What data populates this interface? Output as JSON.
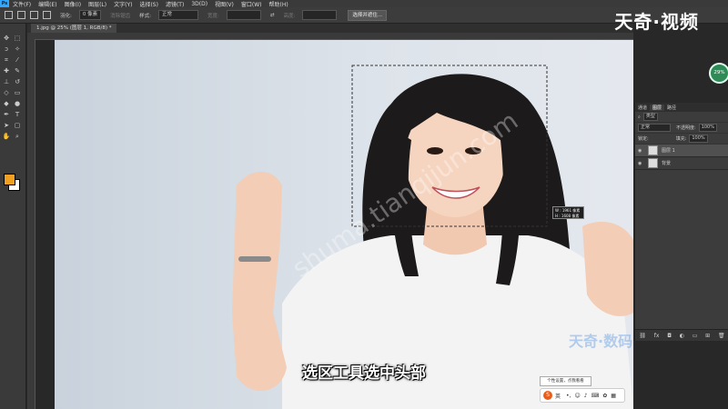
{
  "menu": {
    "items": [
      "文件(F)",
      "编辑(E)",
      "图像(I)",
      "图层(L)",
      "文字(Y)",
      "选择(S)",
      "滤镜(T)",
      "3D(D)",
      "视图(V)",
      "窗口(W)",
      "帮助(H)"
    ]
  },
  "options": {
    "feather_label": "羽化:",
    "feather_value": "0 像素",
    "antialias": "消除锯齿",
    "style_label": "样式:",
    "style_value": "正常",
    "width_label": "宽度:",
    "height_label": "高度:",
    "select_mask_button": "选择并遮住..."
  },
  "document": {
    "tab_title": "1.jpg @ 25% (图层 1, RGB/8) *"
  },
  "layers_panel": {
    "tabs": [
      "图层",
      "通道",
      "路径"
    ],
    "kind_label": "类型",
    "blend_mode": "正常",
    "opacity_label": "不透明度:",
    "opacity_value": "100%",
    "lock_label": "锁定:",
    "fill_label": "填充:",
    "fill_value": "100%",
    "layers": [
      {
        "name": "图层 1",
        "selected": true
      },
      {
        "name": "背景",
        "selected": false
      }
    ]
  },
  "selection_tooltip": {
    "width": "W : 1961 像素",
    "height": "H : 1608 像素"
  },
  "overlay": {
    "brand_logo": "天奇·视频",
    "progress_badge": "29%",
    "subtitle": "选区工具选中头部",
    "watermark_url": "shuma.tianqijun.com",
    "watermark_brand": "天奇·数码",
    "ime_tip": "个性设置，点我看看",
    "ime_lang": "英"
  },
  "colors": {
    "foreground": "#f0a020",
    "background": "#ffffff",
    "badge": "#2e8b57"
  },
  "icons": [
    "move-icon",
    "marquee-icon",
    "lasso-icon",
    "magic-wand-icon",
    "crop-icon",
    "eyedropper-icon",
    "healing-icon",
    "brush-icon",
    "stamp-icon",
    "history-brush-icon",
    "eraser-icon",
    "gradient-icon",
    "blur-icon",
    "dodge-icon",
    "pen-icon",
    "type-icon",
    "path-select-icon",
    "shape-icon",
    "hand-icon",
    "zoom-icon"
  ]
}
